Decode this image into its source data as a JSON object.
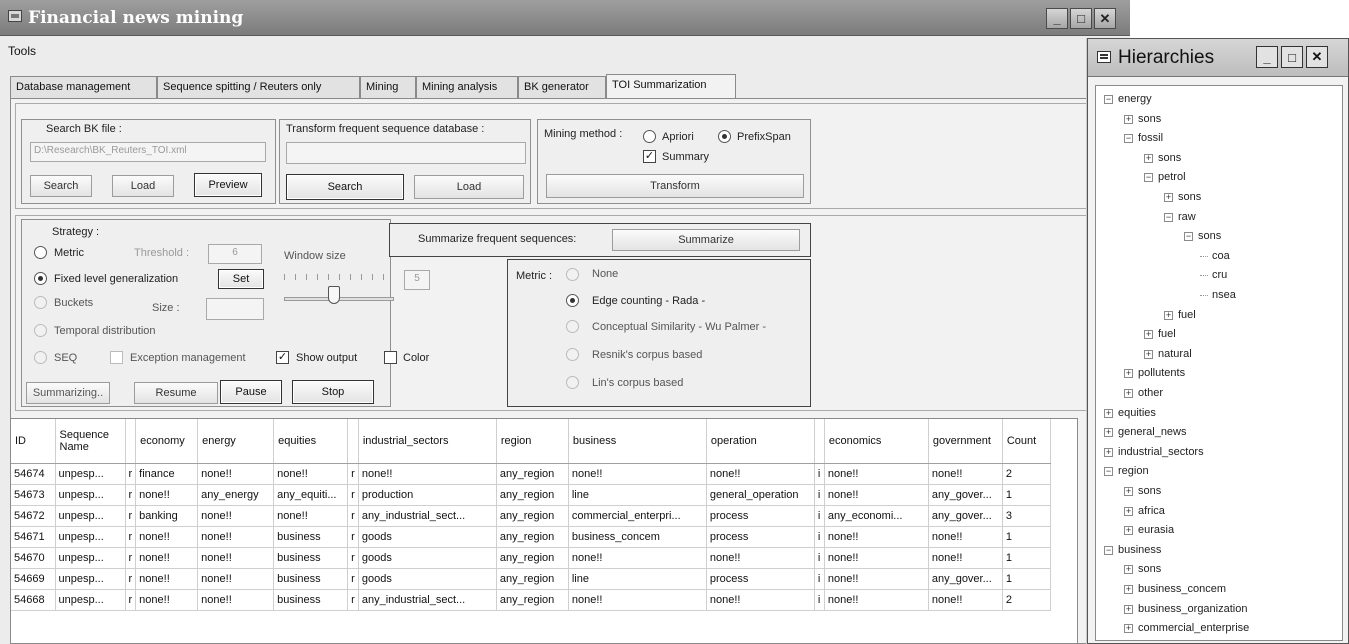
{
  "main_window": {
    "title": "Financial news mining",
    "menu": [
      "Tools"
    ],
    "tabs": [
      "Database management",
      "Sequence spitting / Reuters only",
      "Mining",
      "Mining analysis",
      "BK generator",
      "TOI Summarization"
    ]
  },
  "search_bk": {
    "group_label": "Search BK file :",
    "path": "D:\\Research\\BK_Reuters_TOI.xml",
    "search_label": "Search",
    "load_label": "Load",
    "preview_label": "Preview"
  },
  "transform_db": {
    "group_label": "Transform frequent sequence database :",
    "path": "",
    "search_label": "Search",
    "load_label": "Load"
  },
  "mining_method": {
    "label": "Mining method :",
    "apriori": "Apriori",
    "prefixspan": "PrefixSpan",
    "summary": "Summary",
    "transform_label": "Transform"
  },
  "strategy": {
    "label": "Strategy :",
    "metric": "Metric",
    "threshold_label": "Threshold :",
    "threshold_value": "6",
    "fixed_level": "Fixed level generalization",
    "set_label": "Set",
    "buckets": "Buckets",
    "size_label": "Size :",
    "temporal": "Temporal distribution",
    "seq": "SEQ",
    "exception": "Exception management",
    "show_output": "Show output",
    "color": "Color",
    "window_size_label": "Window size",
    "window_size_value": "5"
  },
  "summarize": {
    "label": "Summarize frequent sequences:",
    "button": "Summarize"
  },
  "metric_box": {
    "label": "Metric :",
    "options": [
      "None",
      "Edge counting - Rada -",
      "Conceptual Similarity - Wu  Palmer -",
      "Resnik's corpus based",
      "Lin's corpus based"
    ]
  },
  "controls": {
    "summarizing": "Summarizing..",
    "resume": "Resume",
    "pause": "Pause",
    "stop": "Stop"
  },
  "table": {
    "headers": [
      "ID",
      "Sequence Name",
      "",
      "economy",
      "energy",
      "equities",
      "",
      "industrial_sectors",
      "region",
      "business",
      "operation",
      "",
      "economics",
      "government",
      "Count"
    ],
    "rows": [
      [
        "54674",
        "unpesp...",
        "r",
        "finance",
        "none!!",
        "none!!",
        "r",
        "none!!",
        "any_region",
        "none!!",
        "none!!",
        "i",
        "none!!",
        "none!!",
        "2"
      ],
      [
        "54673",
        "unpesp...",
        "r",
        "none!!",
        "any_energy",
        "any_equiti...",
        "r",
        "production",
        "any_region",
        "line",
        "general_operation",
        "i",
        "none!!",
        "any_gover...",
        "1"
      ],
      [
        "54672",
        "unpesp...",
        "r",
        "banking",
        "none!!",
        "none!!",
        "r",
        "any_industrial_sect...",
        "any_region",
        "commercial_enterpri...",
        "process",
        "i",
        "any_economi...",
        "any_gover...",
        "3"
      ],
      [
        "54671",
        "unpesp...",
        "r",
        "none!!",
        "none!!",
        "business",
        "r",
        "goods",
        "any_region",
        "business_concem",
        "process",
        "i",
        "none!!",
        "none!!",
        "1"
      ],
      [
        "54670",
        "unpesp...",
        "r",
        "none!!",
        "none!!",
        "business",
        "r",
        "goods",
        "any_region",
        "none!!",
        "none!!",
        "i",
        "none!!",
        "none!!",
        "1"
      ],
      [
        "54669",
        "unpesp...",
        "r",
        "none!!",
        "none!!",
        "business",
        "r",
        "goods",
        "any_region",
        "line",
        "process",
        "i",
        "none!!",
        "any_gover...",
        "1"
      ],
      [
        "54668",
        "unpesp...",
        "r",
        "none!!",
        "none!!",
        "business",
        "r",
        "any_industrial_sect...",
        "any_region",
        "none!!",
        "none!!",
        "i",
        "none!!",
        "none!!",
        "2"
      ]
    ]
  },
  "hierarchies": {
    "title": "Hierarchies",
    "nodes": [
      {
        "label": "energy",
        "sign": "-"
      },
      {
        "label": "sons",
        "sign": "+"
      },
      {
        "label": "fossil",
        "sign": "-"
      },
      {
        "label": "sons",
        "sign": "+"
      },
      {
        "label": "petrol",
        "sign": "-"
      },
      {
        "label": "sons",
        "sign": "+"
      },
      {
        "label": "raw",
        "sign": "-"
      },
      {
        "label": "sons",
        "sign": "-"
      },
      {
        "label": "coa",
        "sign": ""
      },
      {
        "label": "cru",
        "sign": ""
      },
      {
        "label": "nsea",
        "sign": ""
      },
      {
        "label": "fuel",
        "sign": "+"
      },
      {
        "label": "fuel",
        "sign": "+"
      },
      {
        "label": "natural",
        "sign": "+"
      },
      {
        "label": "pollutents",
        "sign": "+"
      },
      {
        "label": "other",
        "sign": "+"
      },
      {
        "label": "equities",
        "sign": "+"
      },
      {
        "label": "general_news",
        "sign": "+"
      },
      {
        "label": "industrial_sectors",
        "sign": "+"
      },
      {
        "label": "region",
        "sign": "-"
      },
      {
        "label": "sons",
        "sign": "+"
      },
      {
        "label": "africa",
        "sign": "+"
      },
      {
        "label": "eurasia",
        "sign": "+"
      },
      {
        "label": "business",
        "sign": "-"
      },
      {
        "label": "sons",
        "sign": "+"
      },
      {
        "label": "business_concem",
        "sign": "+"
      },
      {
        "label": "business_organization",
        "sign": "+"
      },
      {
        "label": "commercial_enterprise",
        "sign": "+"
      }
    ]
  }
}
